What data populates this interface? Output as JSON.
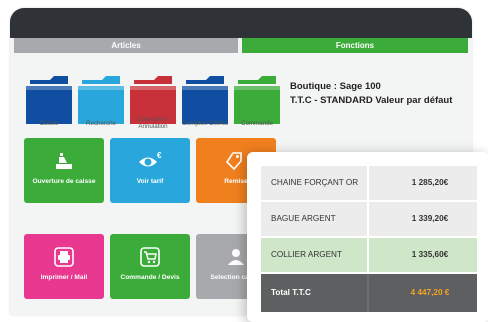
{
  "tabs": {
    "articles": "Articles",
    "fonctions": "Fonctions"
  },
  "folders": [
    {
      "label": "Caisse",
      "color": "#0f4ea1"
    },
    {
      "label": "Recherche",
      "color": "#29a7dc"
    },
    {
      "label": "Correction / Annulation",
      "color": "#c8303a"
    },
    {
      "label": "Comptes Clients",
      "color": "#0f4ea1"
    },
    {
      "label": "Commande",
      "color": "#3bab3a"
    }
  ],
  "info": {
    "line1": "Boutique : Sage 100",
    "line2": "T.T.C - STANDARD Valeur par défaut"
  },
  "tiles": {
    "ouverture": {
      "label": "Ouverture de caisse",
      "icon": "cash-register-icon",
      "color": "#3bab3a"
    },
    "voir_tarif": {
      "label": "Voir tarif",
      "icon": "eye-price-icon",
      "color": "#29a7dc"
    },
    "remise": {
      "label": "Remise",
      "icon": "tag-icon",
      "color": "#f07f1e"
    },
    "imprimer": {
      "label": "Imprimer / Mail",
      "icon": "printer-icon",
      "color": "#e8388f"
    },
    "commande": {
      "label": "Commande / Devis",
      "icon": "cart-icon",
      "color": "#3bab3a"
    },
    "selection": {
      "label": "Selection caisse",
      "icon": "user-icon",
      "color": "#a7a9ac"
    }
  },
  "ticket": {
    "rows": [
      {
        "name": "CHAINE FORÇANT OR",
        "value": "1 285,20€"
      },
      {
        "name": "BAGUE ARGENT",
        "value": "1 339,20€"
      },
      {
        "name": "COLLIER ARGENT",
        "value": "1 335,60€"
      }
    ],
    "total": {
      "name": "Total T.T.C",
      "value": "4 447,20 €"
    }
  },
  "colors": {
    "row_bg": "#ececed",
    "row_highlight": "#cfe6c9",
    "total_bg": "#5d5f60",
    "total_value": "#f4a324"
  }
}
